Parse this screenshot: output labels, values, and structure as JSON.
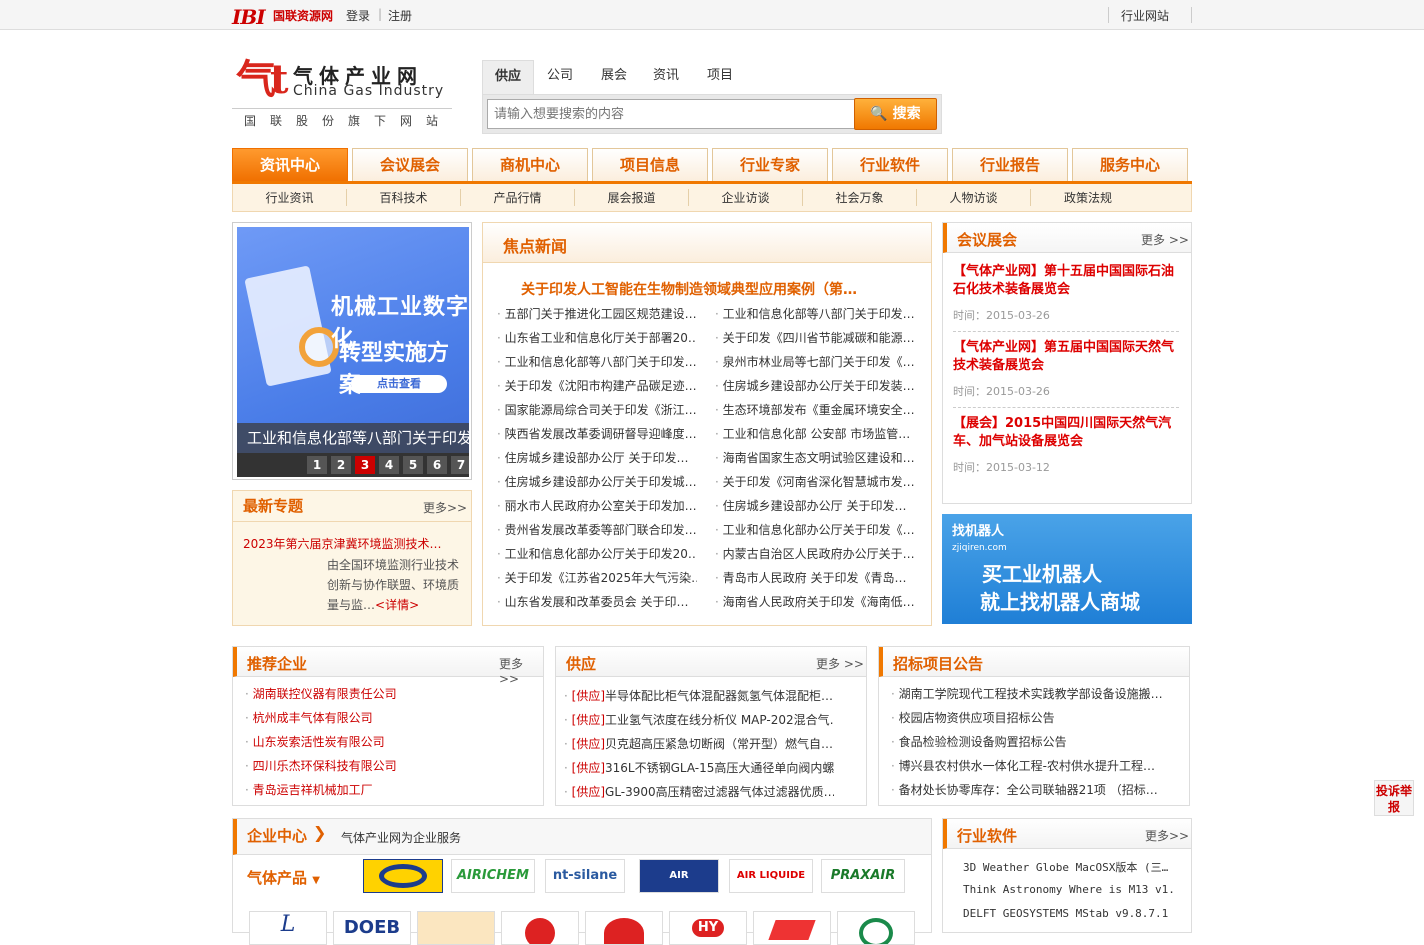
{
  "top": {
    "ibi": "IBI",
    "network": "国联资源网",
    "login": "登录",
    "sep": "|",
    "register": "注册",
    "industry_sites": "行业网站"
  },
  "logo": {
    "mark": "气t",
    "cn": "气体产业网",
    "en": "China Gas Industry",
    "sub": "国联股份旗下网站"
  },
  "search": {
    "tabs": [
      "供应",
      "公司",
      "展会",
      "资讯",
      "项目"
    ],
    "placeholder": "请输入想要搜索的内容",
    "button": "搜索"
  },
  "nav": [
    "资讯中心",
    "会议展会",
    "商机中心",
    "项目信息",
    "行业专家",
    "行业软件",
    "行业报告",
    "服务中心"
  ],
  "subnav": [
    "行业资讯",
    "百科技术",
    "产品行情",
    "展会报道",
    "企业访谈",
    "社会万象",
    "人物访谈",
    "政策法规"
  ],
  "banner": {
    "line1": "机械工业数字化",
    "line2": "转型实施方案",
    "btn": "点击查看",
    "caption": "工业和信息化部等八部门关于印发",
    "pages": [
      "1",
      "2",
      "3",
      "4",
      "5",
      "6",
      "7"
    ],
    "active": 3
  },
  "topic": {
    "title": "最新专题",
    "more": "更多>>",
    "item": "2023年第六届京津冀环境监测技术…",
    "desc": "由全国环境监测行业技术创新与协作联盟、环境质量与监…",
    "detail": "<详情>"
  },
  "focus": {
    "title": "焦点新闻",
    "headline": "关于印发人工智能在生物制造领域典型应用案例（第…",
    "left": [
      "五部门关于推进化工园区规范建设…",
      "山东省工业和信息化厅关于部署20…",
      "工业和信息化部等八部门关于印发…",
      "关于印发《沈阳市构建产品碳足迹…",
      "国家能源局综合司关于印发《浙江…",
      "陕西省发展改革委调研督导迎峰度…",
      "住房城乡建设部办公厅 关于印发…",
      "住房城乡建设部办公厅关于印发城…",
      "丽水市人民政府办公室关于印发加…",
      "贵州省发展改革委等部门联合印发…",
      "工业和信息化部办公厅关于印发20…",
      "关于印发《江苏省2025年大气污染…",
      "山东省发展和改革委员会 关于印…"
    ],
    "right": [
      "工业和信息化部等八部门关于印发…",
      "关于印发《四川省节能减碳和能源…",
      "泉州市林业局等七部门关于印发《…",
      "住房城乡建设部办公厅关于印发装…",
      "生态环境部发布《重金属环境安全…",
      "工业和信息化部 公安部 市场监管…",
      "海南省国家生态文明试验区建设和…",
      "关于印发《河南省深化智慧城市发…",
      "住房城乡建设部办公厅 关于印发…",
      "工业和信息化部办公厅关于印发《…",
      "内蒙古自治区人民政府办公厅关于…",
      "青岛市人民政府 关于印发《青岛…",
      "海南省人民政府关于印发《海南低…"
    ]
  },
  "meet": {
    "title": "会议展会",
    "more": "更多 >>",
    "items": [
      {
        "t": "【气体产业网】第十五届中国国际石油石化技术装备展览会",
        "d": "时间：2015-03-26"
      },
      {
        "t": "【气体产业网】第五届中国国际天然气技术装备展览会",
        "d": "时间：2015-03-26"
      },
      {
        "t": "【展会】2015中国四川国际天然气汽车、加气站设备展览会",
        "d": "时间：2015-03-12"
      }
    ]
  },
  "ad": {
    "brand": "找机器人",
    "domain": "zjiqiren.com",
    "line1": "买工业机器人",
    "line2": "就上找机器人商城"
  },
  "rec": {
    "title": "推荐企业",
    "more": "更多>>",
    "items": [
      "湖南联控仪器有限责任公司",
      "杭州成丰气体有限公司",
      "山东炭索活性炭有限公司",
      "四川乐杰环保科技有限公司",
      "青岛运吉祥机械加工厂"
    ]
  },
  "supply": {
    "title": "供应",
    "more": "更多 >>",
    "tag": "[供应]",
    "items": [
      "半导体配比柜气体混配器氮氢气体混配柜…",
      "工业氢气浓度在线分析仪 MAP-202混合气…",
      "贝克超高压紧急切断阀（常开型）燃气自…",
      "316L不锈钢GLA-15高压大通径单向阀内螺…",
      "GL-3900高压精密过滤器气体过滤器优质…"
    ]
  },
  "bid": {
    "title": "招标项目公告",
    "items": [
      "湖南工学院现代工程技术实践教学部设备设施搬…",
      "校园店物资供应项目招标公告",
      "食品检验检测设备购置招标公告",
      "博兴县农村供水一体化工程-农村供水提升工程…",
      "备材处长协零库存：全公司联轴器21项 （招标…"
    ]
  },
  "ent": {
    "title": "企业中心",
    "sub": "气体产业网为企业服务",
    "gas": "气体产品",
    "logos": [
      "AIRICHEM",
      "nt-silane",
      "AIR PRODUCTS",
      "AIR LIQUIDE",
      "PRAXAIR"
    ],
    "logos2": [
      "L",
      "DOEB",
      "",
      "",
      "",
      "HY",
      "",
      ""
    ]
  },
  "sw": {
    "title": "行业软件",
    "more": "更多>>",
    "items": [
      "3D Weather Globe MacOSX版本 (三…",
      "Think Astronomy Where is M13 v1.…",
      "DELFT GEOSYSTEMS MStab v9.8.7.1 …"
    ]
  },
  "report": "投诉举报",
  "colors": {
    "accent": "#f07800",
    "red": "#cc0000"
  }
}
